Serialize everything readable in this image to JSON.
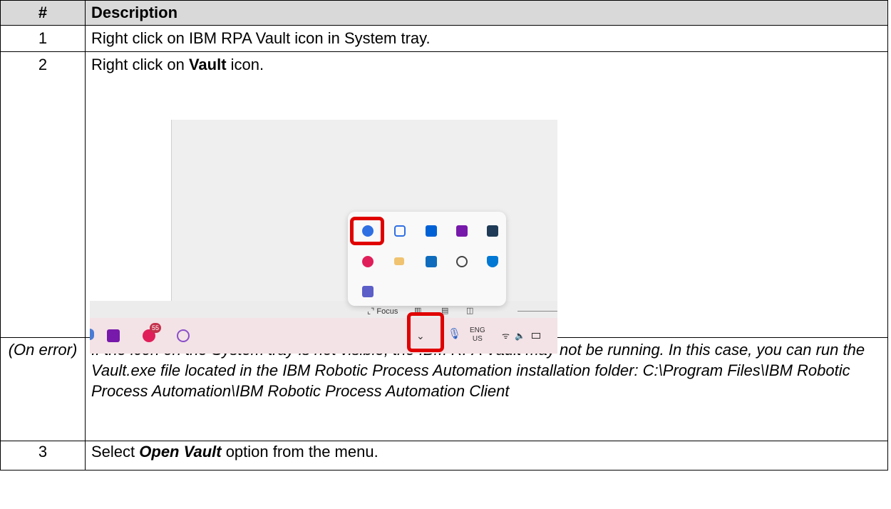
{
  "table": {
    "header": {
      "num": "#",
      "desc": "Description"
    },
    "row1": {
      "num": "1",
      "desc": "Right click on IBM RPA Vault icon in System tray."
    },
    "row2": {
      "num": "2",
      "desc_pre": "Right click on ",
      "desc_bold": "Vault",
      "desc_post": " icon."
    },
    "error": {
      "num": "(On error)",
      "desc": "If the icon on the System tray is not visible, the IBM RPA Vault may not be running. In this case, you can run the Vault.exe file located in the IBM Robotic Process Automation installation folder: C:\\Program Files\\IBM Robotic Process Automation\\IBM Robotic Process Automation Client"
    },
    "row3": {
      "num": "3",
      "desc_pre": "Select ",
      "desc_bold": "Open Vault",
      "desc_post": " option from the menu."
    }
  },
  "screenshot": {
    "focus_label": "Focus",
    "lang_top": "ENG",
    "lang_bottom": "US",
    "badge_count": "55",
    "icons": [
      "vault-icon",
      "robot-icon",
      "box-icon",
      "onenote-icon",
      "app-icon",
      "slack-icon",
      "mail-icon",
      "outlook-icon",
      "sync-icon",
      "defender-icon",
      "teams-icon"
    ],
    "colors": {
      "highlight": "#e00000",
      "vault": "#2f6fe4"
    }
  }
}
